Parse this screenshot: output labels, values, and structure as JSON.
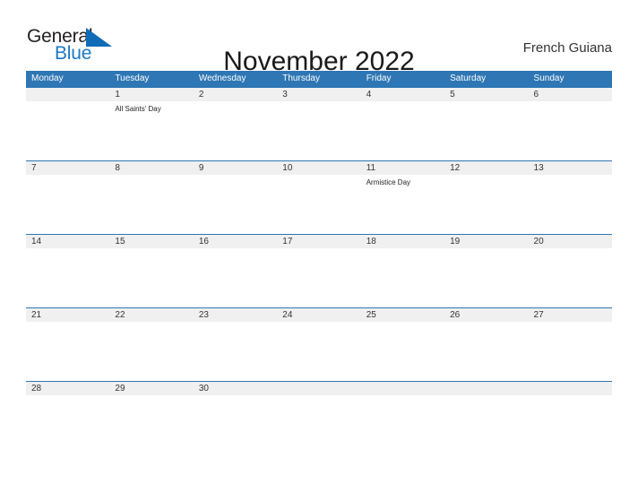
{
  "logo": {
    "text_primary": "General",
    "text_secondary": "Blue",
    "flag_icon": "blue-triangle-flag-icon",
    "brand_blue": "#1a7ac4"
  },
  "header": {
    "title": "November 2022",
    "country": "French Guiana"
  },
  "theme": {
    "header_blue": "#2e76b4",
    "date_band_gray": "#f0f0f0",
    "text_dark": "#333333"
  },
  "calendar": {
    "weekdays": [
      "Monday",
      "Tuesday",
      "Wednesday",
      "Thursday",
      "Friday",
      "Saturday",
      "Sunday"
    ],
    "weeks": [
      {
        "days": [
          {
            "date": "",
            "event": ""
          },
          {
            "date": "1",
            "event": "All Saints' Day"
          },
          {
            "date": "2",
            "event": ""
          },
          {
            "date": "3",
            "event": ""
          },
          {
            "date": "4",
            "event": ""
          },
          {
            "date": "5",
            "event": ""
          },
          {
            "date": "6",
            "event": ""
          }
        ]
      },
      {
        "days": [
          {
            "date": "7",
            "event": ""
          },
          {
            "date": "8",
            "event": ""
          },
          {
            "date": "9",
            "event": ""
          },
          {
            "date": "10",
            "event": ""
          },
          {
            "date": "11",
            "event": "Armistice Day"
          },
          {
            "date": "12",
            "event": ""
          },
          {
            "date": "13",
            "event": ""
          }
        ]
      },
      {
        "days": [
          {
            "date": "14",
            "event": ""
          },
          {
            "date": "15",
            "event": ""
          },
          {
            "date": "16",
            "event": ""
          },
          {
            "date": "17",
            "event": ""
          },
          {
            "date": "18",
            "event": ""
          },
          {
            "date": "19",
            "event": ""
          },
          {
            "date": "20",
            "event": ""
          }
        ]
      },
      {
        "days": [
          {
            "date": "21",
            "event": ""
          },
          {
            "date": "22",
            "event": ""
          },
          {
            "date": "23",
            "event": ""
          },
          {
            "date": "24",
            "event": ""
          },
          {
            "date": "25",
            "event": ""
          },
          {
            "date": "26",
            "event": ""
          },
          {
            "date": "27",
            "event": ""
          }
        ]
      },
      {
        "days": [
          {
            "date": "28",
            "event": ""
          },
          {
            "date": "29",
            "event": ""
          },
          {
            "date": "30",
            "event": ""
          },
          {
            "date": "",
            "event": ""
          },
          {
            "date": "",
            "event": ""
          },
          {
            "date": "",
            "event": ""
          },
          {
            "date": "",
            "event": ""
          }
        ]
      }
    ]
  }
}
